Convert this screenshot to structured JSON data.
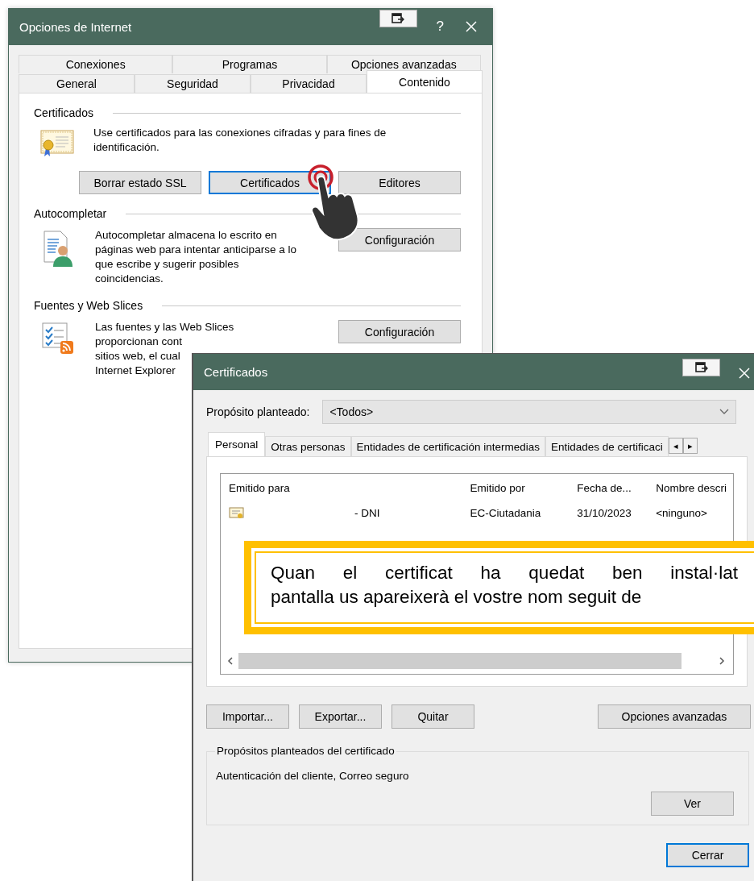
{
  "internet_options": {
    "title": "Opciones de Internet",
    "help": "?",
    "tab_rows": [
      [
        {
          "label": "Conexiones",
          "selected": false
        },
        {
          "label": "Programas",
          "selected": false
        },
        {
          "label": "Opciones avanzadas",
          "selected": false
        }
      ],
      [
        {
          "label": "General",
          "selected": false
        },
        {
          "label": "Seguridad",
          "selected": false
        },
        {
          "label": "Privacidad",
          "selected": false
        },
        {
          "label": "Contenido",
          "selected": true
        }
      ]
    ],
    "sections": [
      {
        "kind": "certificates",
        "heading": "Certificados",
        "lines": [
          "Use certificados para las conexiones cifradas y para fines de identificación."
        ],
        "buttons": [
          {
            "label": "Borrar estado SSL",
            "focused": false
          },
          {
            "label": "Certificados",
            "focused": true
          },
          {
            "label": "Editores",
            "focused": false
          }
        ]
      },
      {
        "kind": "autocomplete",
        "heading": "Autocompletar",
        "lines": [
          "Autocompletar almacena lo escrito en páginas web para intentar anticiparse a lo que escribe y sugerir posibles coincidencias."
        ],
        "buttons": [
          {
            "label": "Configuración",
            "focused": false
          }
        ]
      },
      {
        "kind": "feeds",
        "heading": "Fuentes y Web Slices",
        "lines": [
          "Las fuentes y las Web Slices",
          "proporcionan cont",
          "sitios web, el cual",
          "Internet Explorer"
        ],
        "buttons": [
          {
            "label": "Configuración",
            "focused": false
          }
        ]
      }
    ]
  },
  "certificates": {
    "title": "Certificados",
    "purpose_label": "Propósito planteado:",
    "purpose_value": "<Todos>",
    "tabs": [
      {
        "label": "Personal",
        "selected": true
      },
      {
        "label": "Otras personas",
        "selected": false
      },
      {
        "label": "Entidades de certificación intermedias",
        "selected": false
      },
      {
        "label": "Entidades de certificaci",
        "selected": false
      }
    ],
    "tab_scroll": [
      "◂",
      "▸"
    ],
    "columns": [
      "Emitido para",
      "Emitido por",
      "Fecha de...",
      "Nombre descri"
    ],
    "rows": [
      {
        "cells": [
          "- DNI",
          "EC-Ciutadania",
          "31/10/2023",
          "<ninguno>"
        ]
      }
    ],
    "buttons": [
      "Importar...",
      "Exportar...",
      "Quitar",
      "Opciones avanzadas"
    ],
    "purposes_title": "Propósitos planteados del certificado",
    "purposes_text": "Autenticación del cliente, Correo seguro",
    "view_button": "Ver",
    "close_button": {
      "label": "Cerrar",
      "focused": true
    }
  },
  "callout": {
    "lines": [
      "Quan el certificat ha quedat ben instal·lat",
      "pantalla us apareixerà el vostre nom seguit de"
    ]
  }
}
